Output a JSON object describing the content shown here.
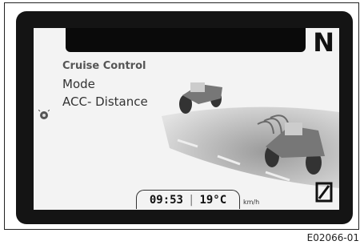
{
  "display": {
    "gear": "N",
    "menu": {
      "title": "Cruise Control",
      "items": [
        "Mode",
        "ACC- Distance"
      ]
    },
    "status": {
      "time": "09:53",
      "temperature": "19°C",
      "speed_unit": "km/h"
    },
    "speed_digit": "0",
    "icons": {
      "side_icon": "sensor-icon"
    }
  },
  "caption": "E02066-01"
}
